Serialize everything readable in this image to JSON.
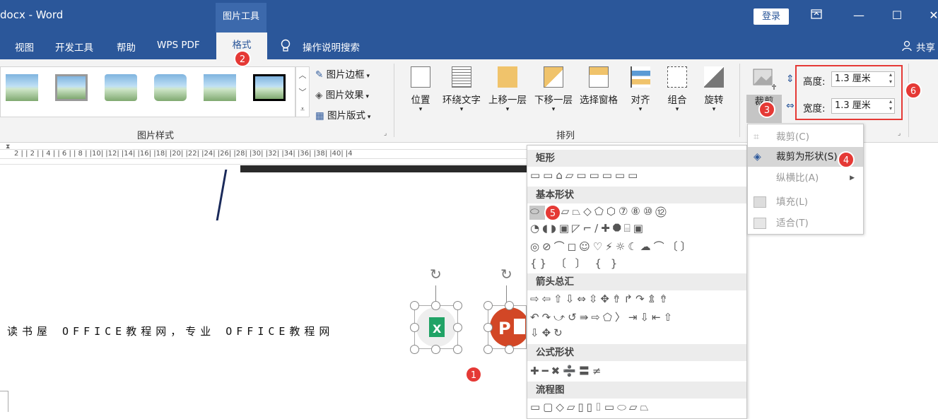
{
  "window": {
    "title": "docx - Word",
    "context_tab_group": "图片工具",
    "login": "登录",
    "share": "共享",
    "controls": {
      "restore_icon": "ribbon-display-icon",
      "minimize": "—",
      "maximize": "☐",
      "close": "✕"
    }
  },
  "tabs": [
    "视图",
    "开发工具",
    "帮助",
    "WPS PDF",
    "格式"
  ],
  "active_tab": "格式",
  "search": {
    "label": "操作说明搜索",
    "icon": "lightbulb-icon"
  },
  "ribbon": {
    "picture_styles": {
      "label": "图片样式",
      "side_buttons": [
        "图片边框",
        "图片效果",
        "图片版式"
      ]
    },
    "arrange": {
      "label": "排列",
      "buttons": [
        "位置",
        "环绕文字",
        "上移一层",
        "下移一层",
        "选择窗格",
        "对齐",
        "组合",
        "旋转"
      ]
    },
    "size": {
      "crop_label": "裁剪",
      "height_label": "高度:",
      "height_value": "1.3 厘米",
      "width_label": "宽度:",
      "width_value": "1.3 厘米"
    }
  },
  "ruler_text": "2 | | 2 | | 4 | | 6 | | 8 | |10| |12| |14| |16| |18| |20| |22| |24| |26| |28| |30| |32| |34| |36| |38| |40| |4",
  "shapes_gallery": {
    "sections": [
      {
        "title": "矩形",
        "rows": [
          "▭▭⌂▱▭▭▭▭▭"
        ]
      },
      {
        "title": "基本形状",
        "rows": [
          "⬭ ▭▱⏢◇⬠⬡⑦⑧⑩⑫",
          "◔◖◗▣◸⌐∕✚⯃⌸▣",
          "◎⊘⌒◻☺♡⚡☼☾☁⌒〔〕",
          "{} 〔 〕 { }"
        ]
      },
      {
        "title": "箭头总汇",
        "rows": [
          "⇨⇦⇧⇩⇔⇳✥⇮↱↷⇭⇮",
          "↶↷⤻↺⇛⇨⬠〉⇥⇩⇤⇧",
          "⇩✥↻"
        ]
      },
      {
        "title": "公式形状",
        "rows": [
          "✚━✖➗〓≠"
        ]
      },
      {
        "title": "流程图",
        "rows": [
          "▭▢◇▱▯▯⌷▭⬭▱⏢"
        ]
      }
    ]
  },
  "crop_menu": {
    "items": [
      {
        "label": "裁剪(C)",
        "enabled": false,
        "icon": "crop-icon"
      },
      {
        "label": "裁剪为形状(S)",
        "enabled": true,
        "icon": "crop-to-shape-icon"
      },
      {
        "label": "纵横比(A)",
        "enabled": false,
        "icon": "",
        "submenu": true
      },
      {
        "label": "填充(L)",
        "enabled": false,
        "icon": "fill-icon"
      },
      {
        "label": "适合(T)",
        "enabled": false,
        "icon": "fit-icon"
      }
    ]
  },
  "document": {
    "text": "读书屋 OFFICE教程网，专业 OFFICE教程网"
  },
  "badges": [
    "1",
    "2",
    "3",
    "4",
    "5",
    "6"
  ]
}
